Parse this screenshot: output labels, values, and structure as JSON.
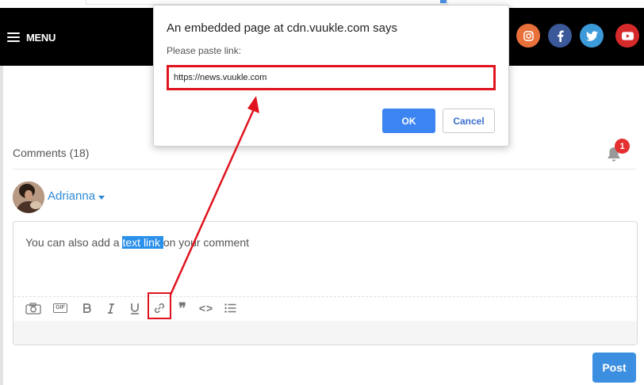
{
  "nav": {
    "menu_label": "MENU",
    "social": [
      {
        "icon": "instagram-icon",
        "color": "#e8703a"
      },
      {
        "icon": "facebook-icon",
        "color": "#3b5998"
      },
      {
        "icon": "twitter-icon",
        "color": "#3d9ad9"
      },
      {
        "icon": "youtube-icon",
        "color": "#d62a2a"
      }
    ]
  },
  "dialog": {
    "title": "An embedded page at cdn.vuukle.com says",
    "prompt": "Please paste link:",
    "input_value": "https://news.vuukle.com",
    "ok_label": "OK",
    "cancel_label": "Cancel"
  },
  "comments": {
    "title": "Comments (18)",
    "notification_count": "1",
    "user_name": "Adrianna",
    "editor_before": "You can also add a ",
    "editor_selected": "text link ",
    "editor_after": "on your comment",
    "post_label": "Post"
  },
  "toolbar": {
    "gif_label": "GIF",
    "quote_glyph": "❞",
    "code_glyph": "<>"
  },
  "colors": {
    "accent": "#3b84f2",
    "annotation_red": "#e0141e",
    "selection": "#2b90ea"
  }
}
